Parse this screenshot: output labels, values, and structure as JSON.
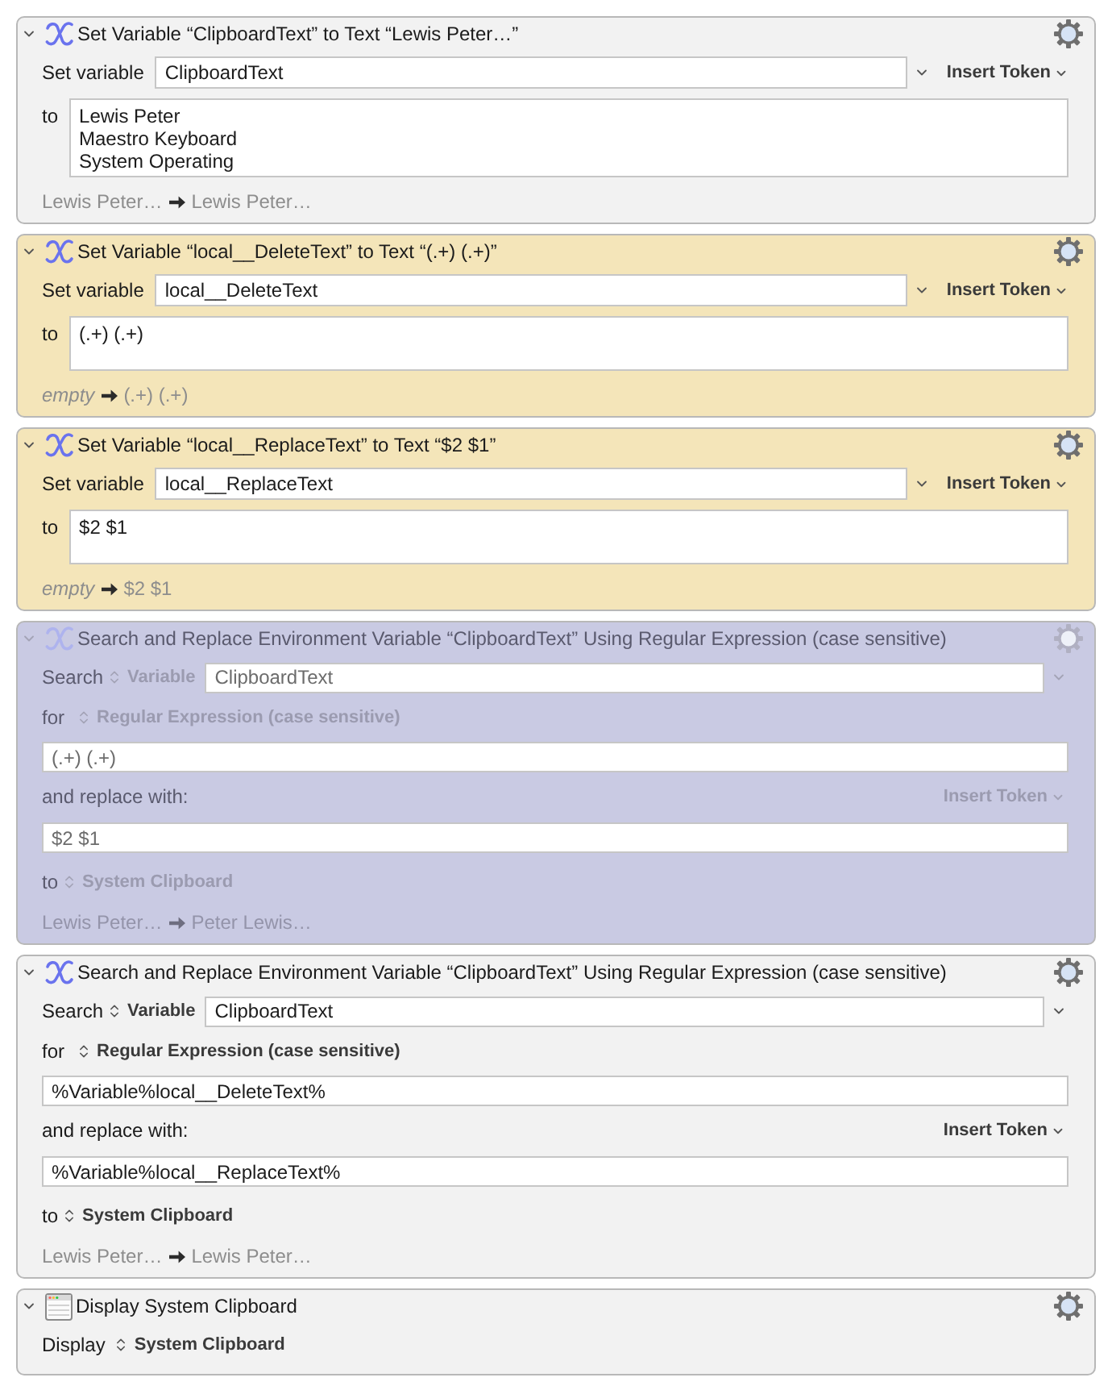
{
  "actions": [
    {
      "kind": "set_variable",
      "color": "#f2f2f2",
      "expanded": true,
      "disabled": false,
      "title": "Set Variable “ClipboardText” to Text “Lewis Peter…”",
      "variable_label": "Set variable",
      "variable": "ClipboardText",
      "insert_token": "Insert Token",
      "to_label": "to",
      "text": "Lewis Peter\nMaestro Keyboard\nSystem Operating",
      "result": {
        "before": "Lewis Peter…",
        "before_empty": false,
        "after": "Lewis Peter…"
      }
    },
    {
      "kind": "set_variable",
      "color": "#f4e5b9",
      "expanded": true,
      "disabled": false,
      "title": "Set Variable “local__DeleteText” to Text “(.+) (.+)”",
      "variable_label": "Set variable",
      "variable": "local__DeleteText",
      "insert_token": "Insert Token",
      "to_label": "to",
      "text": "(.+) (.+)",
      "result": {
        "before": "empty",
        "before_empty": true,
        "after": "(.+) (.+)"
      }
    },
    {
      "kind": "set_variable",
      "color": "#f4e5b9",
      "expanded": true,
      "disabled": false,
      "title": "Set Variable “local__ReplaceText” to Text “$2 $1”",
      "variable_label": "Set variable",
      "variable": "local__ReplaceText",
      "insert_token": "Insert Token",
      "to_label": "to",
      "text": "$2 $1",
      "result": {
        "before": "empty",
        "before_empty": true,
        "after": "$2 $1"
      }
    },
    {
      "kind": "search_replace",
      "color": "#c9cae3",
      "expanded": true,
      "disabled": true,
      "title": "Search and Replace Environment Variable “ClipboardText” Using Regular Expression (case sensitive)",
      "search_label": "Search",
      "source": "Variable",
      "variable": "ClipboardText",
      "for_label": "for",
      "mode": "Regular Expression (case sensitive)",
      "pattern": "(.+) (.+)",
      "replace_label": "and replace with:",
      "insert_token": "Insert Token",
      "replacement": "$2 $1",
      "to_label": "to",
      "destination": "System Clipboard",
      "result": {
        "before": "Lewis Peter…",
        "before_empty": false,
        "after": "Peter Lewis…"
      }
    },
    {
      "kind": "search_replace",
      "color": "#f2f2f2",
      "expanded": true,
      "disabled": false,
      "title": "Search and Replace Environment Variable “ClipboardText” Using Regular Expression (case sensitive)",
      "search_label": "Search",
      "source": "Variable",
      "variable": "ClipboardText",
      "for_label": "for",
      "mode": "Regular Expression (case sensitive)",
      "pattern": "%Variable%local__DeleteText%",
      "replace_label": "and replace with:",
      "insert_token": "Insert Token",
      "replacement": "%Variable%local__ReplaceText%",
      "to_label": "to",
      "destination": "System Clipboard",
      "result": {
        "before": "Lewis Peter…",
        "before_empty": false,
        "after": "Lewis Peter…"
      }
    },
    {
      "kind": "display",
      "color": "#f2f2f2",
      "expanded": true,
      "disabled": false,
      "title": "Display System Clipboard",
      "display_label": "Display",
      "target": "System Clipboard"
    }
  ]
}
